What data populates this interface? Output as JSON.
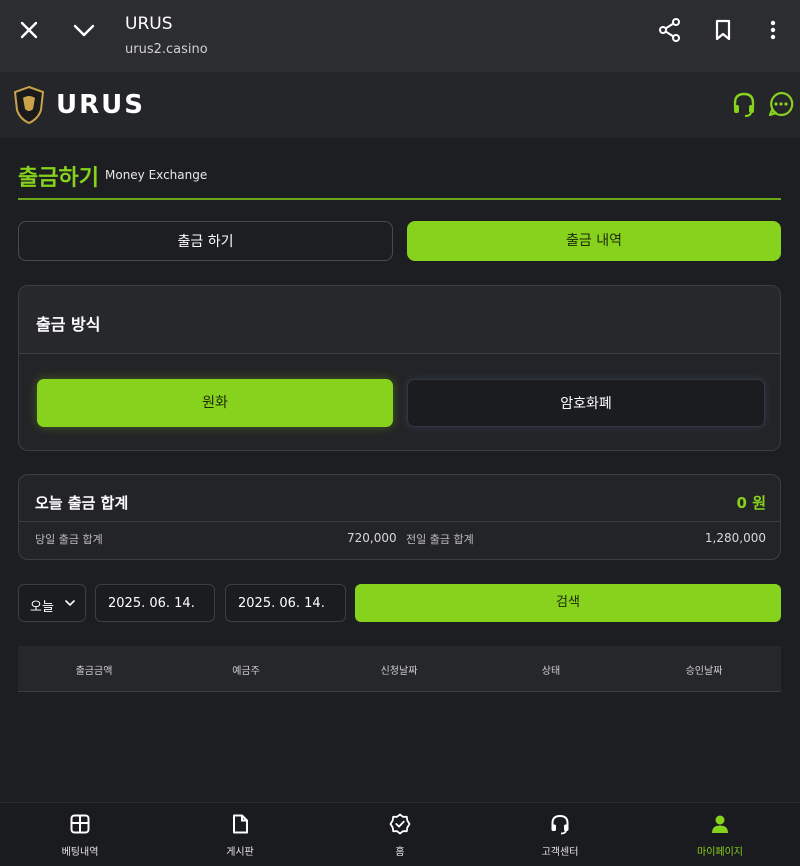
{
  "browser": {
    "title": "URUS",
    "url": "urus2.casino",
    "icons": [
      "close-icon",
      "chevron-down-icon",
      "share-icon",
      "bookmark-icon",
      "more-vert-icon"
    ]
  },
  "site": {
    "logo_text": "URUS",
    "header_icons": [
      "headset-icon",
      "chat-icon"
    ]
  },
  "page": {
    "title": "출금하기",
    "subtitle": "Money Exchange"
  },
  "tabs": {
    "withdraw": "출금 하기",
    "history": "출금 내역",
    "active": "history"
  },
  "method": {
    "title": "출금 방식",
    "krw": "원화",
    "crypto": "암호화폐",
    "selected": "krw"
  },
  "summary": {
    "title": "오늘 출금 합계",
    "amount": "0 원",
    "today_label": "당일 출금 합계",
    "today_value": "720,000",
    "prev_label": "전일 출금 합계",
    "prev_value": "1,280,000"
  },
  "filter": {
    "period": "오늘",
    "start_date": "2025. 06. 14.",
    "end_date": "2025. 06. 14.",
    "search_label": "검색"
  },
  "table": {
    "columns": [
      "출금금액",
      "예금주",
      "신청날짜",
      "상태",
      "승인날짜"
    ],
    "rows": []
  },
  "bottom_nav": {
    "items": [
      {
        "label": "베팅내역",
        "icon": "book-icon"
      },
      {
        "label": "게시판",
        "icon": "document-icon"
      },
      {
        "label": "홈",
        "icon": "badge-check-icon"
      },
      {
        "label": "고객센터",
        "icon": "headset-icon"
      },
      {
        "label": "마이페이지",
        "icon": "user-icon"
      }
    ],
    "active_index": 4
  },
  "colors": {
    "accent": "#86d21c",
    "background": "#1d1e21",
    "card": "#232427"
  }
}
